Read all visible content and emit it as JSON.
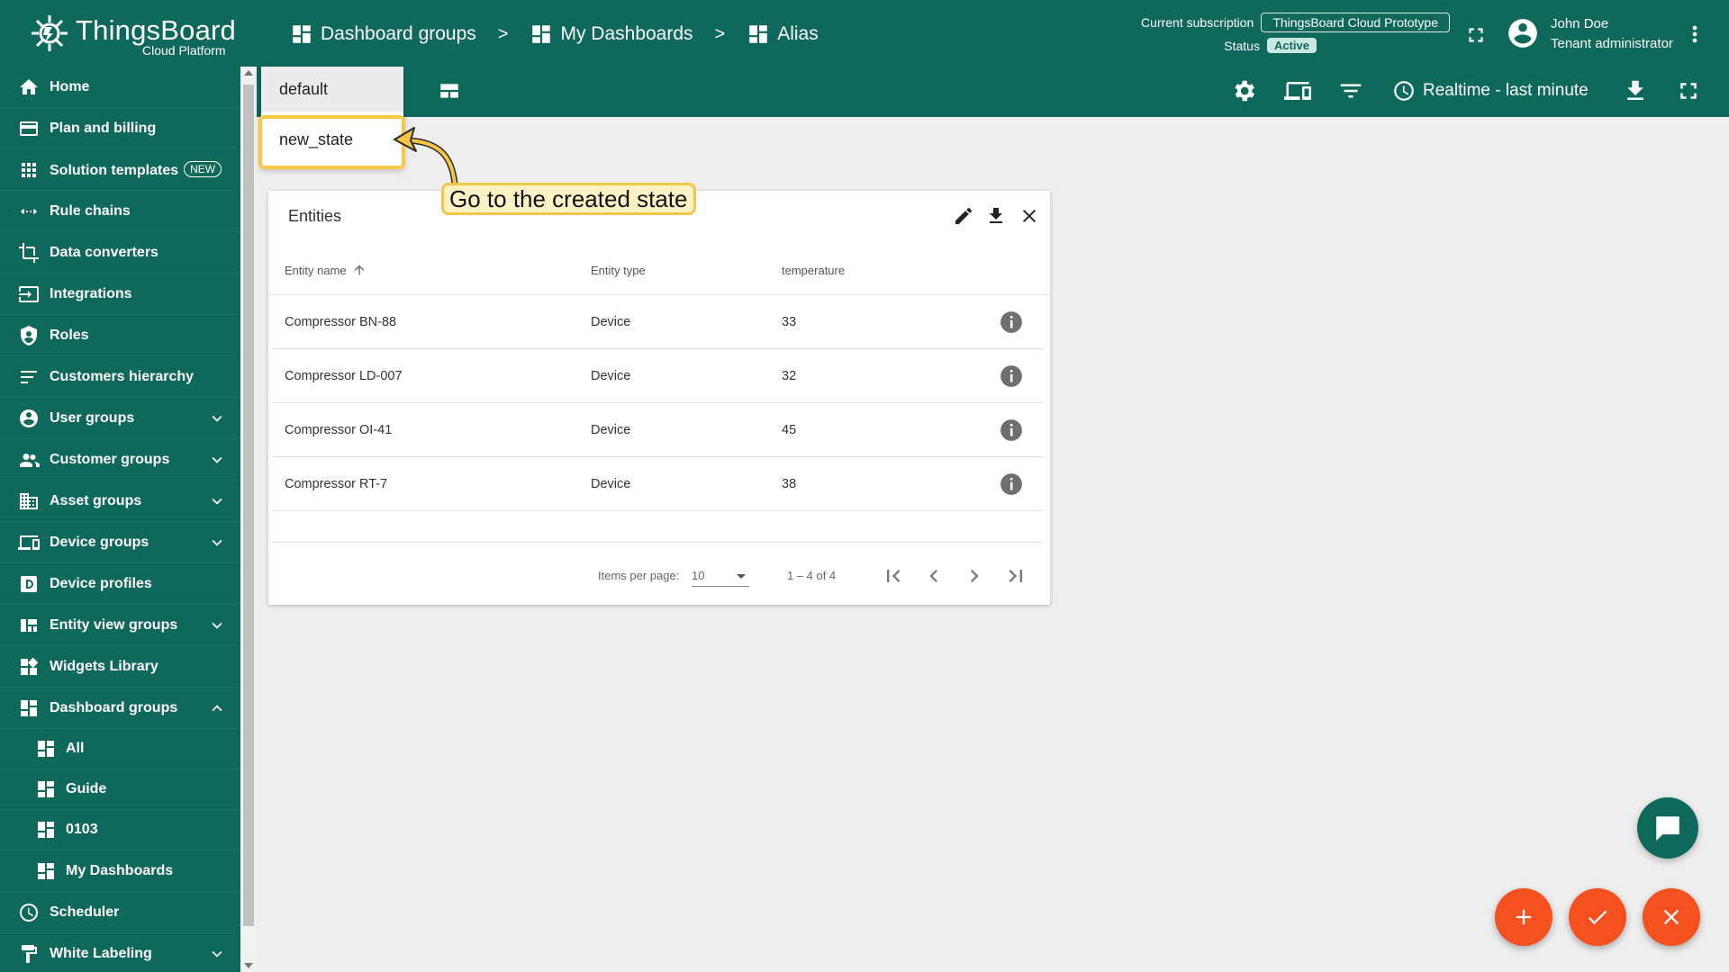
{
  "app": {
    "logo_title": "ThingsBoard",
    "logo_subtitle": "Cloud Platform",
    "accent_color": "#0f695b",
    "fab_color": "#f5511e"
  },
  "breadcrumb": [
    {
      "label": "Dashboard groups",
      "icon": "dashboard-icon"
    },
    {
      "label": "My Dashboards",
      "icon": "dashboard-icon"
    },
    {
      "label": "Alias",
      "icon": "dashboard-icon"
    }
  ],
  "breadcrumb_separator": ">",
  "subscription": {
    "label": "Current subscription",
    "plan": "ThingsBoard Cloud Prototype",
    "status_label": "Status",
    "status": "Active"
  },
  "user": {
    "name": "John Doe",
    "role": "Tenant administrator"
  },
  "toolbar": {
    "timewindow": "Realtime - last minute"
  },
  "sidebar": {
    "items": [
      {
        "label": "Home",
        "icon": "home-icon"
      },
      {
        "label": "Plan and billing",
        "icon": "billing-icon"
      },
      {
        "label": "Solution templates",
        "icon": "apps-icon",
        "badge": "NEW"
      },
      {
        "label": "Rule chains",
        "icon": "rule-chain-icon"
      },
      {
        "label": "Data converters",
        "icon": "converter-icon"
      },
      {
        "label": "Integrations",
        "icon": "integration-icon"
      },
      {
        "label": "Roles",
        "icon": "shield-icon"
      },
      {
        "label": "Customers hierarchy",
        "icon": "hierarchy-icon"
      },
      {
        "label": "User groups",
        "icon": "account-icon",
        "expandable": true
      },
      {
        "label": "Customer groups",
        "icon": "people-icon",
        "expandable": true
      },
      {
        "label": "Asset groups",
        "icon": "domain-icon",
        "expandable": true
      },
      {
        "label": "Device groups",
        "icon": "devices-icon",
        "expandable": true
      },
      {
        "label": "Device profiles",
        "icon": "device-profile-icon"
      },
      {
        "label": "Entity view groups",
        "icon": "view-quilt-icon",
        "expandable": true
      },
      {
        "label": "Widgets Library",
        "icon": "widgets-icon"
      },
      {
        "label": "Dashboard groups",
        "icon": "dashboard-icon",
        "expanded": true
      },
      {
        "label": "All",
        "icon": "dashboard-icon",
        "sub": true
      },
      {
        "label": "Guide",
        "icon": "dashboard-icon",
        "sub": true
      },
      {
        "label": "0103",
        "icon": "dashboard-icon",
        "sub": true
      },
      {
        "label": "My Dashboards",
        "icon": "dashboard-icon",
        "sub": true
      },
      {
        "label": "Scheduler",
        "icon": "schedule-icon"
      },
      {
        "label": "White Labeling",
        "icon": "format-paint-icon",
        "expandable": true
      }
    ]
  },
  "state_menu": {
    "options": [
      "default",
      "new_state"
    ]
  },
  "callout": {
    "text": "Go to the created state"
  },
  "widget": {
    "title": "Entities",
    "columns": [
      "Entity name",
      "Entity type",
      "temperature"
    ],
    "rows": [
      {
        "name": "Compressor BN-88",
        "type": "Device",
        "temperature": "33"
      },
      {
        "name": "Compressor LD-007",
        "type": "Device",
        "temperature": "32"
      },
      {
        "name": "Compressor OI-41",
        "type": "Device",
        "temperature": "45"
      },
      {
        "name": "Compressor RT-7",
        "type": "Device",
        "temperature": "38"
      }
    ],
    "paginator": {
      "items_per_page_label": "Items per page:",
      "items_per_page": "10",
      "range": "1 – 4 of 4"
    }
  }
}
